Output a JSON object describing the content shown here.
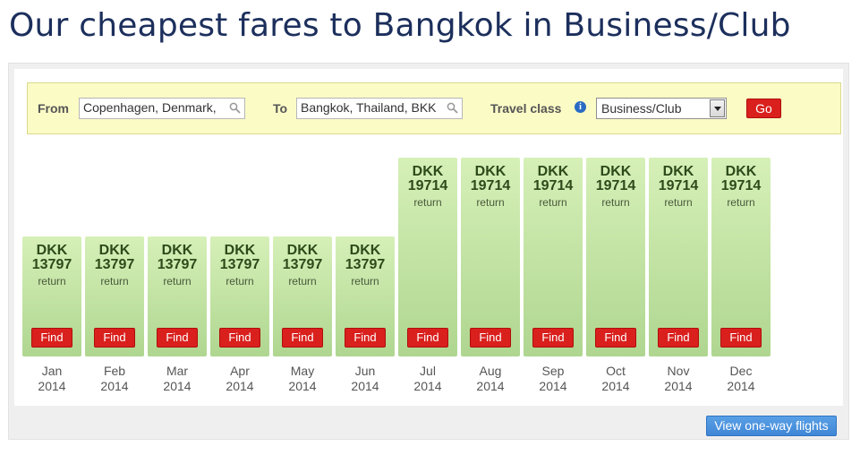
{
  "page": {
    "title": "Our cheapest fares to Bangkok in Business/Club"
  },
  "search": {
    "from_label": "From",
    "from_value": "Copenhagen, Denmark,",
    "to_label": "To",
    "to_value": "Bangkok, Thailand, BKK",
    "class_label": "Travel class",
    "class_value": "Business/Club",
    "go_label": "Go"
  },
  "colors": {
    "title": "#1c2f5c",
    "button_red": "#d9201d",
    "bar_green_top": "#d6f0b8",
    "bar_green_bottom": "#afd690",
    "search_bg": "#fbfbc6",
    "link_button_blue": "#3f86d6"
  },
  "fares": [
    {
      "currency": "DKK",
      "amount": "13797",
      "note": "return",
      "find_label": "Find",
      "month": "Jan",
      "year": "2014"
    },
    {
      "currency": "DKK",
      "amount": "13797",
      "note": "return",
      "find_label": "Find",
      "month": "Feb",
      "year": "2014"
    },
    {
      "currency": "DKK",
      "amount": "13797",
      "note": "return",
      "find_label": "Find",
      "month": "Mar",
      "year": "2014"
    },
    {
      "currency": "DKK",
      "amount": "13797",
      "note": "return",
      "find_label": "Find",
      "month": "Apr",
      "year": "2014"
    },
    {
      "currency": "DKK",
      "amount": "13797",
      "note": "return",
      "find_label": "Find",
      "month": "May",
      "year": "2014"
    },
    {
      "currency": "DKK",
      "amount": "13797",
      "note": "return",
      "find_label": "Find",
      "month": "Jun",
      "year": "2014"
    },
    {
      "currency": "DKK",
      "amount": "19714",
      "note": "return",
      "find_label": "Find",
      "month": "Jul",
      "year": "2014"
    },
    {
      "currency": "DKK",
      "amount": "19714",
      "note": "return",
      "find_label": "Find",
      "month": "Aug",
      "year": "2014"
    },
    {
      "currency": "DKK",
      "amount": "19714",
      "note": "return",
      "find_label": "Find",
      "month": "Sep",
      "year": "2014"
    },
    {
      "currency": "DKK",
      "amount": "19714",
      "note": "return",
      "find_label": "Find",
      "month": "Oct",
      "year": "2014"
    },
    {
      "currency": "DKK",
      "amount": "19714",
      "note": "return",
      "find_label": "Find",
      "month": "Nov",
      "year": "2014"
    },
    {
      "currency": "DKK",
      "amount": "19714",
      "note": "return",
      "find_label": "Find",
      "month": "Dec",
      "year": "2014"
    }
  ],
  "footer": {
    "oneway_label": "View one-way flights"
  }
}
